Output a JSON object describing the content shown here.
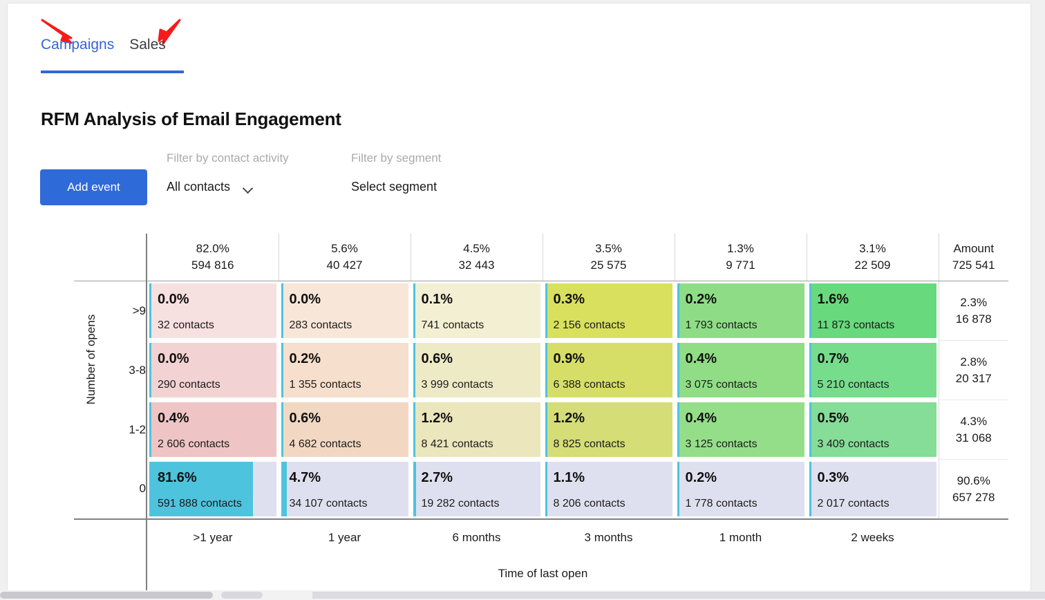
{
  "tabs": [
    {
      "label": "Campaigns",
      "active": true
    },
    {
      "label": "Sales",
      "active": false
    }
  ],
  "page_title": "RFM Analysis of Email Engagement",
  "toolbar": {
    "add_event_label": "Add event",
    "contact_activity_label": "Filter by contact activity",
    "contact_activity_value": "All contacts",
    "segment_label": "Filter by segment",
    "segment_value": "Select segment",
    "chevron_icon": "chevron-down-icon"
  },
  "colors": {
    "accent_blue": "#2f6ad9",
    "tab_active": "#3266d6",
    "bar_cyan": "#4ec3dd",
    "arrow_red": "#f81a1a"
  },
  "chart_data": {
    "type": "heatmap",
    "title": "RFM Analysis of Email Engagement",
    "xlabel": "Time of last open",
    "ylabel": "Number of opens",
    "x_categories": [
      ">1 year",
      "1 year",
      "6 months",
      "3 months",
      "1 month",
      "2 weeks"
    ],
    "y_categories": [
      ">9",
      "3-8",
      "1-2",
      "0"
    ],
    "column_totals": [
      {
        "pct": "82.0%",
        "count": "594 816"
      },
      {
        "pct": "5.6%",
        "count": "40 427"
      },
      {
        "pct": "4.5%",
        "count": "32 443"
      },
      {
        "pct": "3.5%",
        "count": "25 575"
      },
      {
        "pct": "1.3%",
        "count": "9 771"
      },
      {
        "pct": "3.1%",
        "count": "22 509"
      }
    ],
    "amount_header": {
      "label": "Amount",
      "total": "725 541"
    },
    "row_totals": [
      {
        "pct": "2.3%",
        "count": "16 878"
      },
      {
        "pct": "2.8%",
        "count": "20 317"
      },
      {
        "pct": "4.3%",
        "count": "31 068"
      },
      {
        "pct": "90.6%",
        "count": "657 278"
      }
    ],
    "rows": [
      {
        "label": ">9",
        "cells": [
          {
            "pct": "0.0%",
            "value": 0.0,
            "contacts": "32 contacts",
            "bg": "#f7e0e0",
            "bar_pct": 0.0
          },
          {
            "pct": "0.0%",
            "value": 0.0,
            "contacts": "283 contacts",
            "bg": "#f8e6d9",
            "bar_pct": 0.0
          },
          {
            "pct": "0.1%",
            "value": 0.1,
            "contacts": "741 contacts",
            "bg": "#f2efd3",
            "bar_pct": 0.1
          },
          {
            "pct": "0.3%",
            "value": 0.3,
            "contacts": "2 156 contacts",
            "bg": "#d8e05e",
            "bar_pct": 0.3
          },
          {
            "pct": "0.2%",
            "value": 0.2,
            "contacts": "1 793 contacts",
            "bg": "#8edd86",
            "bar_pct": 0.2
          },
          {
            "pct": "1.6%",
            "value": 1.6,
            "contacts": "11 873 contacts",
            "bg": "#68d97c",
            "bar_pct": 1.6
          }
        ]
      },
      {
        "label": "3-8",
        "cells": [
          {
            "pct": "0.0%",
            "value": 0.0,
            "contacts": "290 contacts",
            "bg": "#f2d2d2",
            "bar_pct": 0.0
          },
          {
            "pct": "0.2%",
            "value": 0.2,
            "contacts": "1 355 contacts",
            "bg": "#f6dfcc",
            "bar_pct": 0.2
          },
          {
            "pct": "0.6%",
            "value": 0.6,
            "contacts": "3 999 contacts",
            "bg": "#eeeac6",
            "bar_pct": 0.6
          },
          {
            "pct": "0.9%",
            "value": 0.9,
            "contacts": "6 388 contacts",
            "bg": "#d6de68",
            "bar_pct": 0.9
          },
          {
            "pct": "0.4%",
            "value": 0.4,
            "contacts": "3 075 contacts",
            "bg": "#90dd85",
            "bar_pct": 0.4
          },
          {
            "pct": "0.7%",
            "value": 0.7,
            "contacts": "5 210 contacts",
            "bg": "#76dd8d",
            "bar_pct": 0.7
          }
        ]
      },
      {
        "label": "1-2",
        "cells": [
          {
            "pct": "0.4%",
            "value": 0.4,
            "contacts": "2 606 contacts",
            "bg": "#eec4c4",
            "bar_pct": 0.4
          },
          {
            "pct": "0.6%",
            "value": 0.6,
            "contacts": "4 682 contacts",
            "bg": "#f2d8c3",
            "bar_pct": 0.6
          },
          {
            "pct": "1.2%",
            "value": 1.2,
            "contacts": "8 421 contacts",
            "bg": "#ebe6bb",
            "bar_pct": 1.2
          },
          {
            "pct": "1.2%",
            "value": 1.2,
            "contacts": "8 825 contacts",
            "bg": "#d5dd76",
            "bar_pct": 1.2
          },
          {
            "pct": "0.4%",
            "value": 0.4,
            "contacts": "3 125 contacts",
            "bg": "#95de89",
            "bar_pct": 0.4
          },
          {
            "pct": "0.5%",
            "value": 0.5,
            "contacts": "3 409 contacts",
            "bg": "#85dd97",
            "bar_pct": 0.5
          }
        ]
      },
      {
        "label": "0",
        "cells": [
          {
            "pct": "81.6%",
            "value": 81.6,
            "contacts": "591 888 contacts",
            "bg": "#dfe0ef",
            "bar_pct": 81.6
          },
          {
            "pct": "4.7%",
            "value": 4.7,
            "contacts": "34 107 contacts",
            "bg": "#dfe0ef",
            "bar_pct": 4.7
          },
          {
            "pct": "2.7%",
            "value": 2.7,
            "contacts": "19 282 contacts",
            "bg": "#dfe0ef",
            "bar_pct": 2.7
          },
          {
            "pct": "1.1%",
            "value": 1.1,
            "contacts": "8 206 contacts",
            "bg": "#dfe0ef",
            "bar_pct": 1.1
          },
          {
            "pct": "0.2%",
            "value": 0.2,
            "contacts": "1 778 contacts",
            "bg": "#dfe0ef",
            "bar_pct": 0.2
          },
          {
            "pct": "0.3%",
            "value": 0.3,
            "contacts": "2 017 contacts",
            "bg": "#dfe0ef",
            "bar_pct": 0.3
          }
        ]
      }
    ]
  }
}
